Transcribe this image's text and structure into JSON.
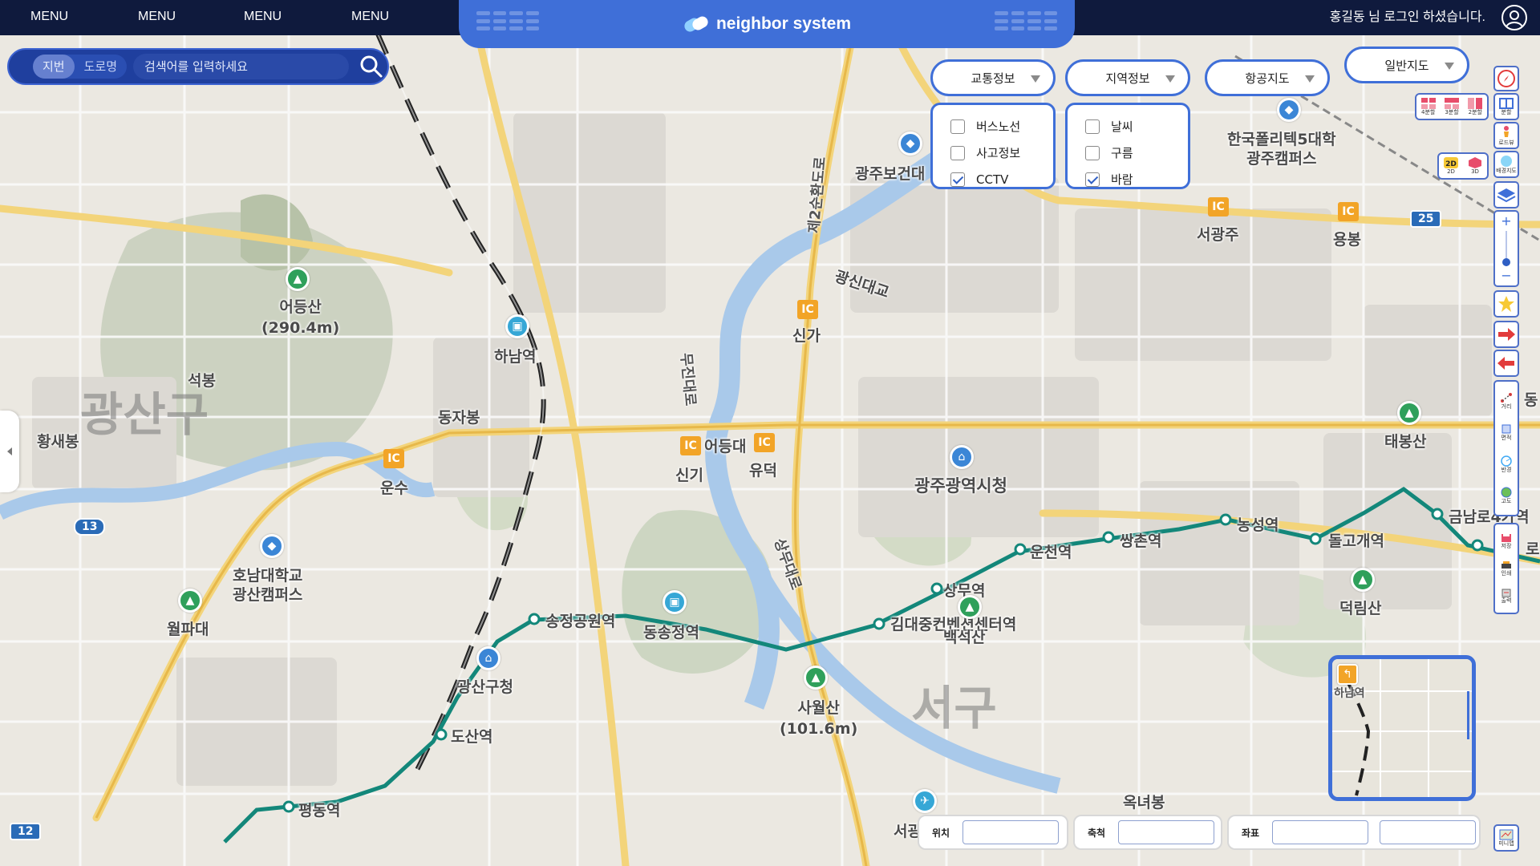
{
  "topbar": {
    "menus": [
      "MENU",
      "MENU",
      "MENU",
      "MENU"
    ],
    "brand": "neighbor system",
    "login_text": "홍길동 님 로그인 하셨습니다."
  },
  "search": {
    "tabs": [
      "지번",
      "도로명"
    ],
    "active_tab": "지번",
    "placeholder": "검색어를 입력하세요"
  },
  "layers": {
    "traffic": {
      "label": "교통정보",
      "options": [
        {
          "label": "버스노선",
          "checked": false
        },
        {
          "label": "사고정보",
          "checked": false
        },
        {
          "label": "CCTV",
          "checked": true
        }
      ]
    },
    "region": {
      "label": "지역정보",
      "options": [
        {
          "label": "날씨",
          "checked": false
        },
        {
          "label": "구름",
          "checked": false
        },
        {
          "label": "바람",
          "checked": true
        }
      ]
    },
    "aerial": {
      "label": "항공지도"
    },
    "basemap": {
      "label": "일반지도"
    }
  },
  "view_controls": {
    "split": [
      "4분할",
      "3분할",
      "2분할"
    ],
    "dim": [
      "2D",
      "3D"
    ]
  },
  "toolbar": {
    "compass": "",
    "split_label": "분할",
    "roadview": "로드뷰",
    "background": "배경지도",
    "measure_distance": "거리",
    "measure_area": "면적",
    "measure_radius": "반경",
    "altitude": "고도",
    "save": "저장",
    "print": "인쇄",
    "export": "출력",
    "minimap": "미니맵"
  },
  "status": {
    "location_label": "위치",
    "scale_label": "축척",
    "coord_label": "좌표"
  },
  "map": {
    "labels": [
      {
        "t": "광산구",
        "cls": "district"
      },
      {
        "t": "서구",
        "cls": "district"
      },
      {
        "t": "어등산\n(290.4m)",
        "cls": ""
      },
      {
        "t": "석봉",
        "cls": ""
      },
      {
        "t": "동자봉",
        "cls": ""
      },
      {
        "t": "황새봉",
        "cls": ""
      },
      {
        "t": "하남역",
        "cls": ""
      },
      {
        "t": "운수",
        "cls": ""
      },
      {
        "t": "호남대학교\n광산캠퍼스",
        "cls": ""
      },
      {
        "t": "월파대",
        "cls": ""
      },
      {
        "t": "광산구청",
        "cls": ""
      },
      {
        "t": "도산역",
        "cls": ""
      },
      {
        "t": "평동역",
        "cls": ""
      },
      {
        "t": "송정공원역",
        "cls": ""
      },
      {
        "t": "동송정역",
        "cls": ""
      },
      {
        "t": "신기",
        "cls": ""
      },
      {
        "t": "어등대",
        "cls": ""
      },
      {
        "t": "유덕",
        "cls": ""
      },
      {
        "t": "신가",
        "cls": ""
      },
      {
        "t": "광신대교",
        "cls": ""
      },
      {
        "t": "광주보건대",
        "cls": ""
      },
      {
        "t": "한국폴리텍5대학\n광주캠퍼스",
        "cls": ""
      },
      {
        "t": "서광주",
        "cls": ""
      },
      {
        "t": "용봉",
        "cls": ""
      },
      {
        "t": "태봉산",
        "cls": ""
      },
      {
        "t": "광주광역시청",
        "cls": ""
      },
      {
        "t": "운천역",
        "cls": ""
      },
      {
        "t": "쌍촌역",
        "cls": ""
      },
      {
        "t": "농성역",
        "cls": ""
      },
      {
        "t": "돌고개역",
        "cls": ""
      },
      {
        "t": "금남로4가역",
        "cls": ""
      },
      {
        "t": "상무역",
        "cls": ""
      },
      {
        "t": "김대중컨벤션센터역",
        "cls": ""
      },
      {
        "t": "백석산",
        "cls": ""
      },
      {
        "t": "사월산\n(101.6m)",
        "cls": ""
      },
      {
        "t": "덕림산",
        "cls": ""
      },
      {
        "t": "옥녀봉",
        "cls": ""
      },
      {
        "t": "서광",
        "cls": ""
      },
      {
        "t": "상무대로",
        "cls": ""
      },
      {
        "t": "제2순환도로",
        "cls": ""
      },
      {
        "t": "무진대로",
        "cls": ""
      },
      {
        "t": "광주공항",
        "cls": ""
      },
      {
        "t": "동",
        "cls": ""
      },
      {
        "t": "로",
        "cls": ""
      }
    ],
    "route_shields": [
      "13",
      "12",
      "25"
    ],
    "ic_label": "IC"
  },
  "minimap": {
    "label": "하남역"
  }
}
